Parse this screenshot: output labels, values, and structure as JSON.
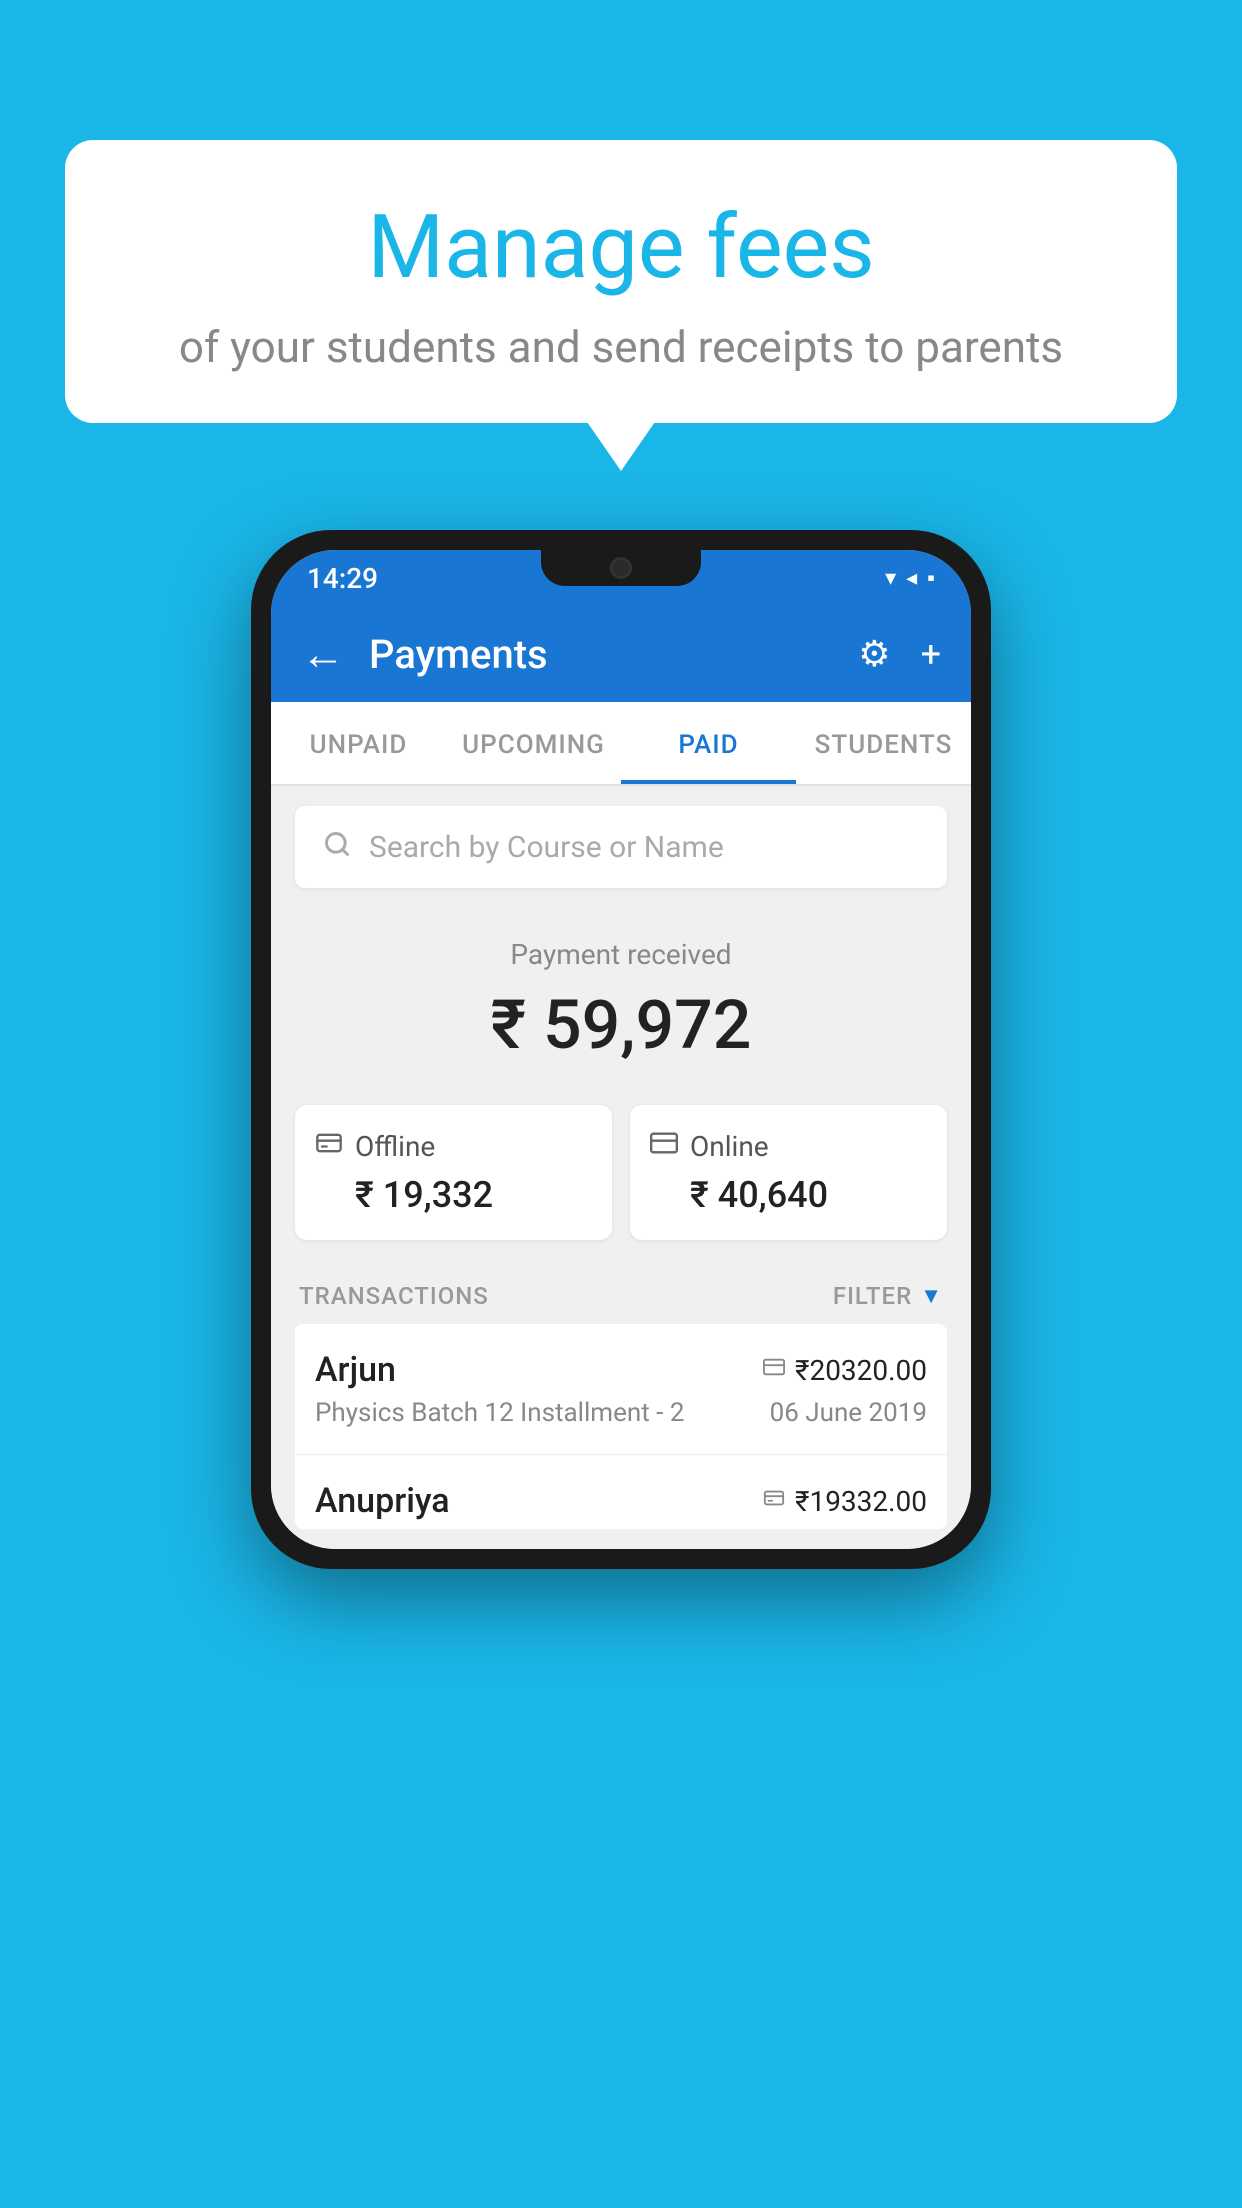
{
  "hero": {
    "title": "Manage fees",
    "subtitle": "of your students and send receipts to parents"
  },
  "status_bar": {
    "time": "14:29",
    "icons": "▾◂▪"
  },
  "app_bar": {
    "back_icon": "←",
    "title": "Payments",
    "settings_icon": "⚙",
    "add_icon": "+"
  },
  "tabs": [
    {
      "label": "UNPAID",
      "active": false
    },
    {
      "label": "UPCOMING",
      "active": false
    },
    {
      "label": "PAID",
      "active": true
    },
    {
      "label": "STUDENTS",
      "active": false
    }
  ],
  "search": {
    "placeholder": "Search by Course or Name"
  },
  "payment_summary": {
    "label": "Payment received",
    "amount": "₹ 59,972"
  },
  "payment_cards": [
    {
      "type": "Offline",
      "amount": "₹ 19,332",
      "icon": "💳"
    },
    {
      "type": "Online",
      "amount": "₹ 40,640",
      "icon": "💳"
    }
  ],
  "transactions": {
    "label": "TRANSACTIONS",
    "filter_label": "FILTER",
    "items": [
      {
        "name": "Arjun",
        "course": "Physics Batch 12 Installment - 2",
        "amount": "₹20320.00",
        "date": "06 June 2019",
        "payment_icon": "card"
      },
      {
        "name": "Anupriya",
        "course": "",
        "amount": "₹19332.00",
        "date": "",
        "payment_icon": "cash"
      }
    ]
  }
}
